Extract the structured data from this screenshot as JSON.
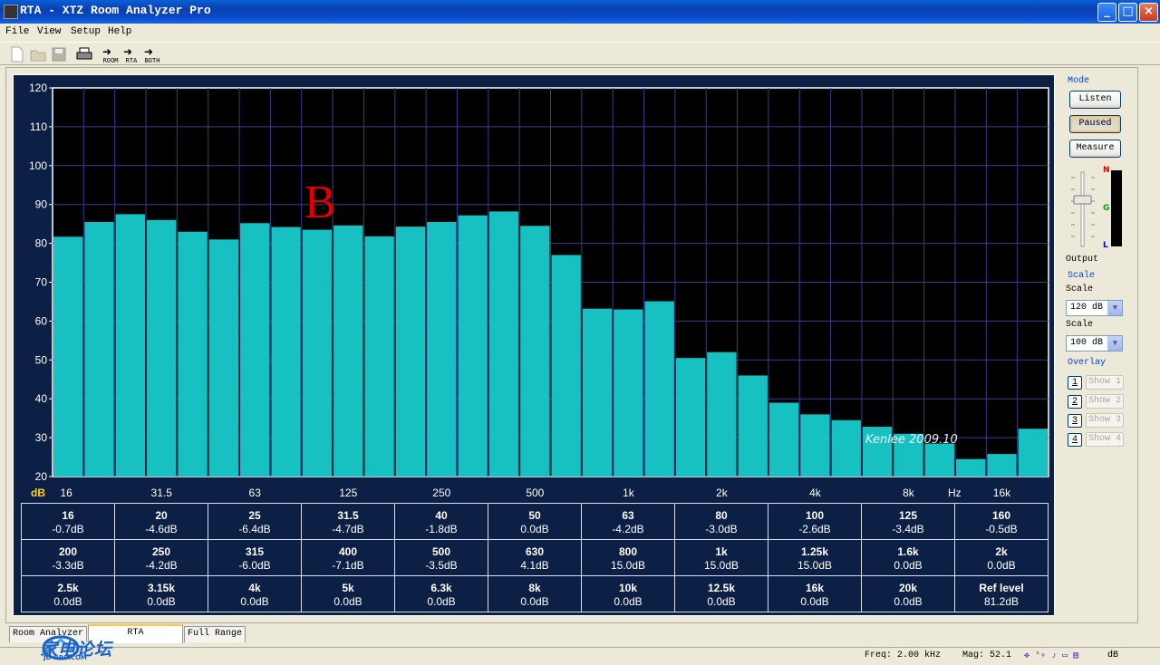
{
  "window": {
    "title": "RTA - XTZ Room Analyzer Pro"
  },
  "menu": [
    "File",
    "View",
    "Setup",
    "Help"
  ],
  "toolbar": {
    "room": "ROOM",
    "rta": "RTA",
    "both": "BOTH"
  },
  "side": {
    "mode_label": "Mode",
    "listen": "Listen",
    "paused": "Paused",
    "measure": "Measure",
    "meter_n": "N",
    "meter_g": "G",
    "meter_l": "L",
    "output_label": "Output",
    "scale_group": "Scale",
    "scale1_label": "Scale",
    "scale1_value": "120 dB",
    "scale2_label": "Scale",
    "scale2_value": "100 dB",
    "overlay_label": "Overlay",
    "overlays": [
      {
        "num": "1",
        "show": "Show 1"
      },
      {
        "num": "2",
        "show": "Show 2"
      },
      {
        "num": "3",
        "show": "Show 3"
      },
      {
        "num": "4",
        "show": "Show 4"
      }
    ]
  },
  "annotation": "B",
  "watermark": "Kenlee  2009.10",
  "chart_data": {
    "type": "bar",
    "ylabel": "dB",
    "xlabel": "Hz",
    "ylim": [
      20,
      120
    ],
    "yticks": [
      20,
      30,
      40,
      50,
      60,
      70,
      80,
      90,
      100,
      110,
      120
    ],
    "xtick_labels": [
      "16",
      "31.5",
      "63",
      "125",
      "250",
      "500",
      "1k",
      "2k",
      "4k",
      "8k",
      "16k"
    ],
    "categories": [
      "16",
      "20",
      "25",
      "31.5",
      "40",
      "50",
      "63",
      "80",
      "100",
      "125",
      "160",
      "200",
      "250",
      "315",
      "400",
      "500",
      "630",
      "800",
      "1k",
      "1.25k",
      "1.6k",
      "2k",
      "2.5k",
      "3.15k",
      "4k",
      "5k",
      "6.3k",
      "8k",
      "10k",
      "12.5k",
      "16k",
      "20k"
    ],
    "values": [
      81.7,
      85.5,
      87.5,
      86,
      83,
      81,
      85.2,
      84.2,
      83.5,
      84.6,
      81.8,
      84.3,
      85.5,
      87.2,
      88.2,
      84.5,
      77,
      63.2,
      63,
      65.1,
      50.5,
      52,
      46,
      39,
      36,
      34.5,
      32.8,
      31,
      28.5,
      24.5,
      25.8,
      32.3
    ],
    "grid": true,
    "bar_color": "#17c1c1",
    "background": "#000000"
  },
  "table": [
    [
      [
        "16",
        "-0.7dB"
      ],
      [
        "20",
        "-4.6dB"
      ],
      [
        "25",
        "-6.4dB"
      ],
      [
        "31.5",
        "-4.7dB"
      ],
      [
        "40",
        "-1.8dB"
      ],
      [
        "50",
        "0.0dB"
      ],
      [
        "63",
        "-4.2dB"
      ],
      [
        "80",
        "-3.0dB"
      ],
      [
        "100",
        "-2.6dB"
      ],
      [
        "125",
        "-3.4dB"
      ],
      [
        "160",
        "-0.5dB"
      ]
    ],
    [
      [
        "200",
        "-3.3dB"
      ],
      [
        "250",
        "-4.2dB"
      ],
      [
        "315",
        "-6.0dB"
      ],
      [
        "400",
        "-7.1dB"
      ],
      [
        "500",
        "-3.5dB"
      ],
      [
        "630",
        "4.1dB"
      ],
      [
        "800",
        "15.0dB"
      ],
      [
        "1k",
        "15.0dB"
      ],
      [
        "1.25k",
        "15.0dB"
      ],
      [
        "1.6k",
        "0.0dB"
      ],
      [
        "2k",
        "0.0dB"
      ]
    ],
    [
      [
        "2.5k",
        "0.0dB"
      ],
      [
        "3.15k",
        "0.0dB"
      ],
      [
        "4k",
        "0.0dB"
      ],
      [
        "5k",
        "0.0dB"
      ],
      [
        "6.3k",
        "0.0dB"
      ],
      [
        "8k",
        "0.0dB"
      ],
      [
        "10k",
        "0.0dB"
      ],
      [
        "12.5k",
        "0.0dB"
      ],
      [
        "16k",
        "0.0dB"
      ],
      [
        "20k",
        "0.0dB"
      ],
      [
        "Ref level",
        "81.2dB"
      ]
    ]
  ],
  "tabs": [
    "Room Analyzer",
    "RTA",
    "Full Range"
  ],
  "status": {
    "freq": "Freq: 2.00 kHz",
    "mag": "Mag: 52.1",
    "unit": "dB"
  },
  "logo": {
    "name": "家电论坛",
    "sub": "JD-BBS.COM"
  }
}
